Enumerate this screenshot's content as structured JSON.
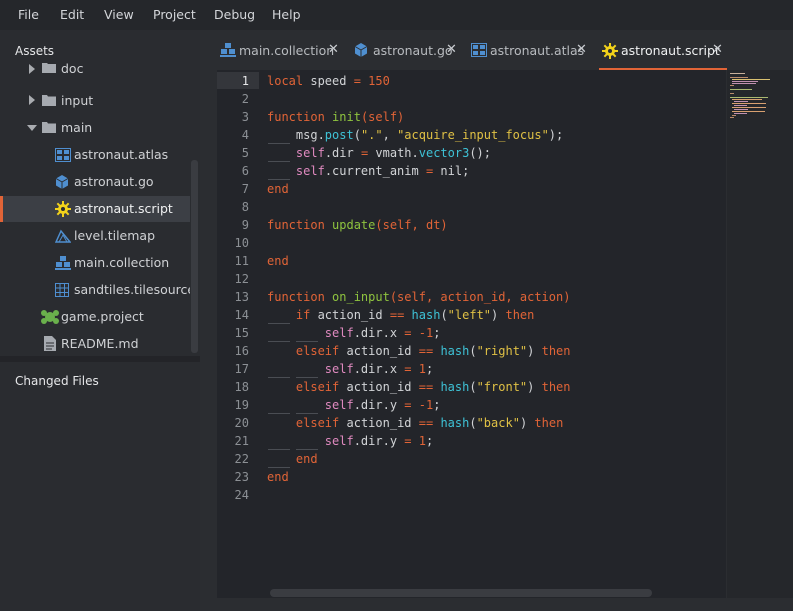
{
  "menubar": {
    "items": [
      "File",
      "Edit",
      "View",
      "Project",
      "Debug",
      "Help"
    ]
  },
  "sidebar": {
    "assets_title": "Assets",
    "changed_files_title": "Changed Files",
    "tree": [
      {
        "label": "doc",
        "icon": "folder-icon",
        "arrow": "chevron-right"
      },
      {
        "label": "input",
        "icon": "folder-icon",
        "arrow": "chevron-right"
      },
      {
        "label": "main",
        "icon": "folder-icon",
        "arrow": "chevron-down"
      },
      {
        "label": "astronaut.atlas",
        "icon": "atlas-icon"
      },
      {
        "label": "astronaut.go",
        "icon": "game-object-icon"
      },
      {
        "label": "astronaut.script",
        "icon": "script-gear-icon",
        "selected": true
      },
      {
        "label": "level.tilemap",
        "icon": "tilemap-icon"
      },
      {
        "label": "main.collection",
        "icon": "collection-icon"
      },
      {
        "label": "sandtiles.tilesource",
        "icon": "tilesource-icon"
      },
      {
        "label": "game.project",
        "icon": "game-project-icon"
      },
      {
        "label": "README.md",
        "icon": "document-icon"
      }
    ]
  },
  "tabs": [
    {
      "label": "main.collection",
      "icon": "collection-icon"
    },
    {
      "label": "astronaut.go",
      "icon": "game-object-icon"
    },
    {
      "label": "astronaut.atlas",
      "icon": "atlas-icon"
    },
    {
      "label": "astronaut.script",
      "icon": "script-gear-icon",
      "active": true
    }
  ],
  "colors": {
    "accent": "#e16437",
    "keyword": "#e16437",
    "function": "#8fc43f",
    "string": "#e0c145",
    "builtin": "#3ec2d6",
    "self": "#e08ac0"
  },
  "editor": {
    "current_line": 1,
    "line_numbers": [
      "1",
      "2",
      "3",
      "4",
      "5",
      "6",
      "7",
      "8",
      "9",
      "10",
      "11",
      "12",
      "13",
      "14",
      "15",
      "16",
      "17",
      "18",
      "19",
      "20",
      "21",
      "22",
      "23",
      "24"
    ],
    "lines": [
      "local speed = 150",
      "",
      "function init(self)",
      "    msg.post(\".\", \"acquire_input_focus\");",
      "    self.dir = vmath.vector3();",
      "    self.current_anim = nil;",
      "end",
      "",
      "function update(self, dt)",
      "",
      "end",
      "",
      "function on_input(self, action_id, action)",
      "    if action_id == hash(\"left\") then",
      "        self.dir.x = -1;",
      "    elseif action_id == hash(\"right\") then",
      "        self.dir.x = 1;",
      "    elseif action_id == hash(\"front\") then",
      "        self.dir.y = -1;",
      "    elseif action_id == hash(\"back\") then",
      "        self.dir.y = 1;",
      "    end",
      "end",
      ""
    ]
  }
}
